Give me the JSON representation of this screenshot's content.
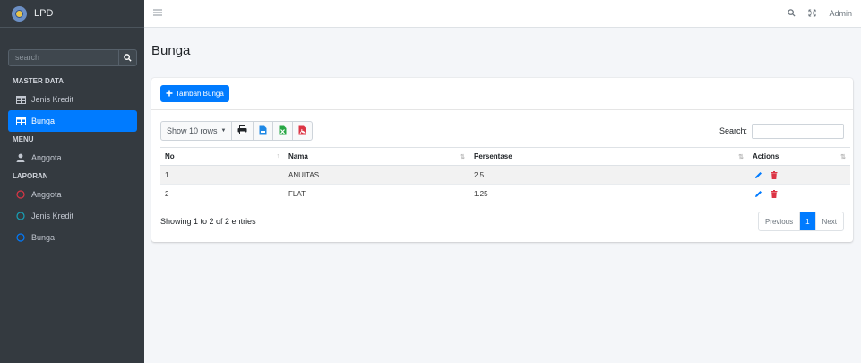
{
  "brand": {
    "title": "LPD"
  },
  "sidebar": {
    "search": {
      "placeholder": "search"
    },
    "sections": [
      {
        "header": "MASTER DATA",
        "items": [
          {
            "label": "Jenis Kredit",
            "icon": "table-icon"
          },
          {
            "label": "Bunga",
            "icon": "table-icon",
            "active": true
          }
        ]
      },
      {
        "header": "MENU",
        "items": [
          {
            "label": "Anggota",
            "icon": "user-icon"
          }
        ]
      },
      {
        "header": "LAPORAN",
        "items": [
          {
            "label": "Anggota",
            "icon": "circle-icon",
            "color": "#dc3545"
          },
          {
            "label": "Jenis Kredit",
            "icon": "circle-icon",
            "color": "#17a2b8"
          },
          {
            "label": "Bunga",
            "icon": "circle-icon",
            "color": "#007bff"
          }
        ]
      }
    ]
  },
  "navbar": {
    "user": "Admin"
  },
  "page": {
    "title": "Bunga"
  },
  "card": {
    "add_label": "Tambah Bunga",
    "toolbar": {
      "show_rows": "Show 10 rows",
      "search_label": "Search:"
    },
    "table": {
      "headers": [
        "No",
        "Nama",
        "Persentase",
        "Actions"
      ],
      "rows": [
        {
          "no": "1",
          "nama": "ANUITAS",
          "persentase": "2.5"
        },
        {
          "no": "2",
          "nama": "FLAT",
          "persentase": "1.25"
        }
      ]
    },
    "footer": {
      "info": "Showing 1 to 2 of 2 entries",
      "prev": "Previous",
      "page": "1",
      "next": "Next"
    }
  },
  "colors": {
    "primary": "#007bff",
    "sidebar_bg": "#343a40",
    "danger": "#dc3545",
    "info": "#17a2b8"
  }
}
